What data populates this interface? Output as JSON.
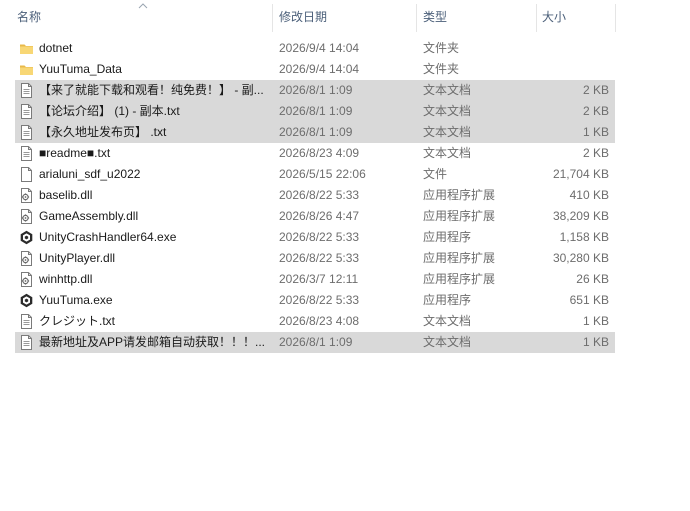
{
  "columns": {
    "name": "名称",
    "date": "修改日期",
    "type": "类型",
    "size": "大小"
  },
  "files": [
    {
      "name": "dotnet",
      "date": "2026/9/4 14:04",
      "type": "文件夹",
      "size": "",
      "icon": "folder-icon",
      "selected": false
    },
    {
      "name": "YuuTuma_Data",
      "date": "2026/9/4 14:04",
      "type": "文件夹",
      "size": "",
      "icon": "folder-icon",
      "selected": false
    },
    {
      "name": "【来了就能下载和观看！纯免费！】 - 副...",
      "date": "2026/8/1 1:09",
      "type": "文本文档",
      "size": "2 KB",
      "icon": "text-file-icon",
      "selected": true
    },
    {
      "name": "【论坛介绍】 (1) - 副本.txt",
      "date": "2026/8/1 1:09",
      "type": "文本文档",
      "size": "2 KB",
      "icon": "text-file-icon",
      "selected": true
    },
    {
      "name": "【永久地址发布页】 .txt",
      "date": "2026/8/1 1:09",
      "type": "文本文档",
      "size": "1 KB",
      "icon": "text-file-icon",
      "selected": true
    },
    {
      "name": "■readme■.txt",
      "date": "2026/8/23 4:09",
      "type": "文本文档",
      "size": "2 KB",
      "icon": "text-file-icon",
      "selected": false
    },
    {
      "name": "arialuni_sdf_u2022",
      "date": "2026/5/15 22:06",
      "type": "文件",
      "size": "21,704 KB",
      "icon": "file-icon",
      "selected": false
    },
    {
      "name": "baselib.dll",
      "date": "2026/8/22 5:33",
      "type": "应用程序扩展",
      "size": "410 KB",
      "icon": "dll-icon",
      "selected": false
    },
    {
      "name": "GameAssembly.dll",
      "date": "2026/8/26 4:47",
      "type": "应用程序扩展",
      "size": "38,209 KB",
      "icon": "dll-icon",
      "selected": false
    },
    {
      "name": "UnityCrashHandler64.exe",
      "date": "2026/8/22 5:33",
      "type": "应用程序",
      "size": "1,158 KB",
      "icon": "unity-exe-icon",
      "selected": false
    },
    {
      "name": "UnityPlayer.dll",
      "date": "2026/8/22 5:33",
      "type": "应用程序扩展",
      "size": "30,280 KB",
      "icon": "dll-icon",
      "selected": false
    },
    {
      "name": "winhttp.dll",
      "date": "2026/3/7 12:11",
      "type": "应用程序扩展",
      "size": "26 KB",
      "icon": "dll-icon",
      "selected": false
    },
    {
      "name": "YuuTuma.exe",
      "date": "2026/8/22 5:33",
      "type": "应用程序",
      "size": "651 KB",
      "icon": "unity-exe-icon",
      "selected": false
    },
    {
      "name": "クレジット.txt",
      "date": "2026/8/23 4:08",
      "type": "文本文档",
      "size": "1 KB",
      "icon": "text-file-icon",
      "selected": false
    },
    {
      "name": "最新地址及APP请发邮箱自动获取！！！...",
      "date": "2026/8/1 1:09",
      "type": "文本文档",
      "size": "1 KB",
      "icon": "text-file-icon",
      "selected": true
    }
  ],
  "colors": {
    "header_text": "#4c607a",
    "selection": "#d9d9d9",
    "folder": "#f8d775",
    "secondary_text": "#6d6d6d"
  }
}
